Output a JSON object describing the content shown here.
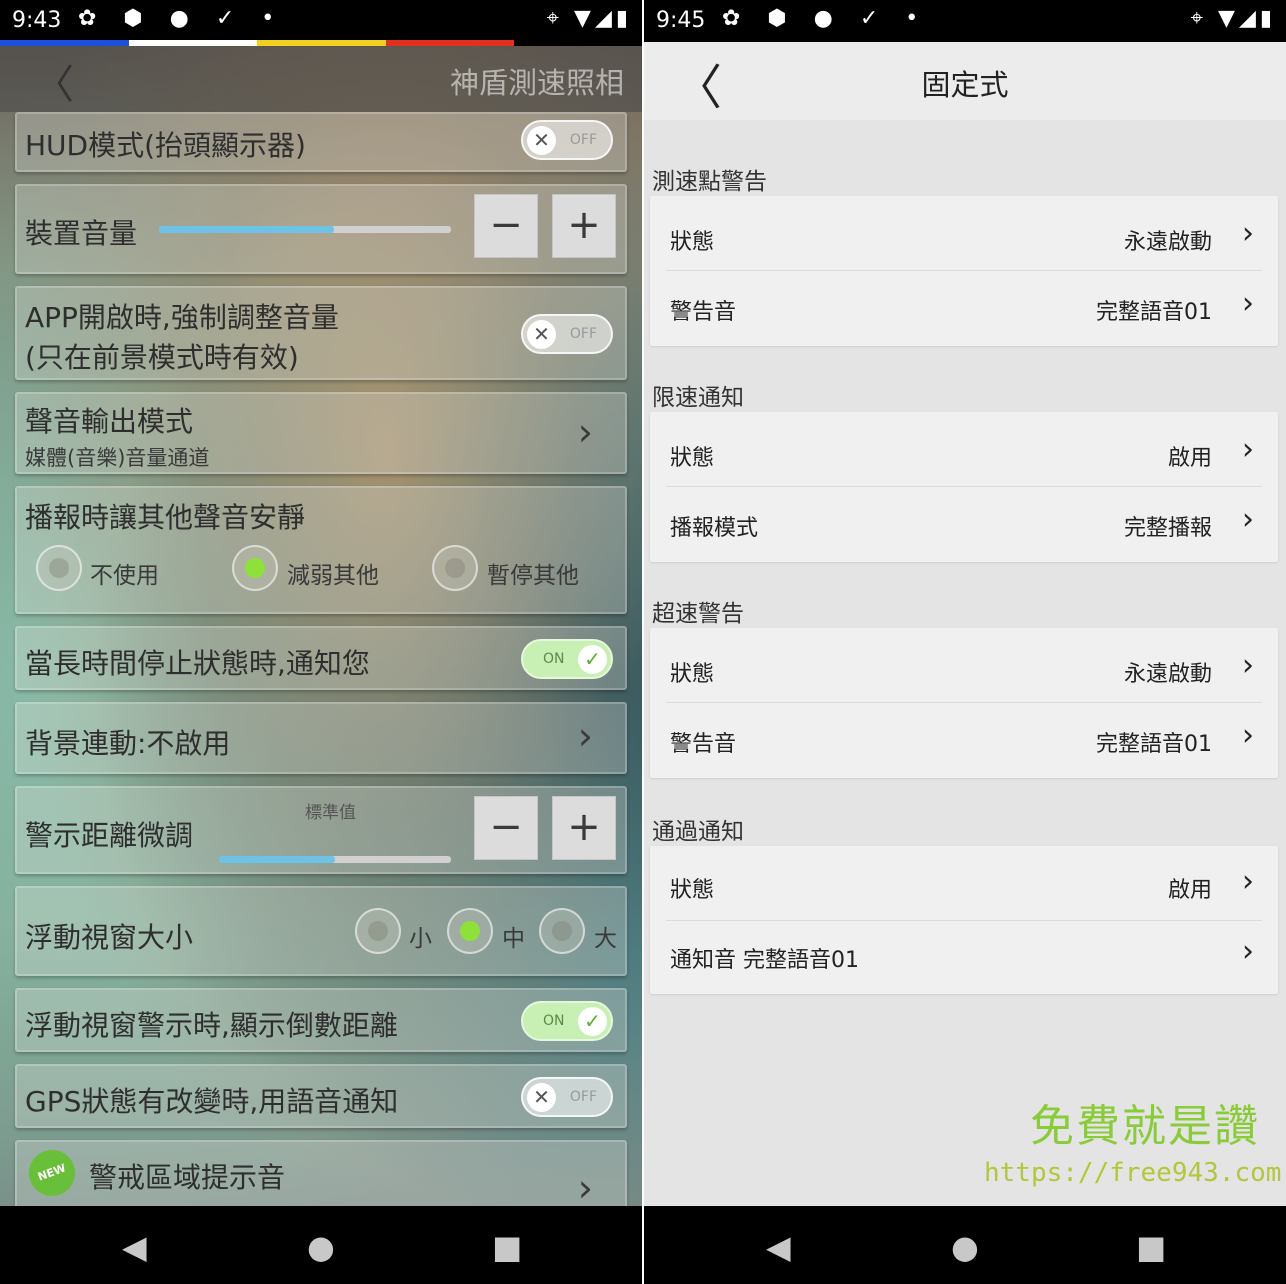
{
  "left": {
    "status": {
      "time": "9:43",
      "left_icons": "✿ ⬢ ● ✓ •",
      "right_icons": "⌖ ▼◢▮"
    },
    "strip_colors": [
      "#1e4fd8",
      "#ffffff",
      "#f0d21e",
      "#e03020"
    ],
    "header": {
      "back": "〈",
      "title": "神盾測速照相"
    },
    "hud": {
      "label": "HUD模式(抬頭顯示器)",
      "toggle": "OFF"
    },
    "volume": {
      "label": "裝置音量",
      "minus": "−",
      "plus": "+",
      "level": 0.6
    },
    "force_volume": {
      "line1": "APP開啟時,強制調整音量",
      "line2": "(只在前景模式時有效)",
      "toggle": "OFF"
    },
    "output": {
      "label": "聲音輸出模式",
      "sub": "媒體(音樂)音量通道",
      "chevron": "›"
    },
    "quiet": {
      "label": "播報時讓其他聲音安靜",
      "options": [
        "不使用",
        "減弱其他",
        "暫停其他"
      ],
      "selected": 1
    },
    "long_stop": {
      "label": "當長時間停止狀態時,通知您",
      "toggle": "ON"
    },
    "background": {
      "label": "背景連動:不啟用",
      "chevron": "›"
    },
    "distance": {
      "label": "警示距離微調",
      "value_label": "標準值",
      "minus": "−",
      "plus": "+",
      "level": 0.5
    },
    "float_size": {
      "label": "浮動視窗大小",
      "options": [
        "小",
        "中",
        "大"
      ],
      "selected": 1
    },
    "float_countdown": {
      "label": "浮動視窗警示時,顯示倒數距離",
      "toggle": "ON"
    },
    "gps": {
      "label": "GPS狀態有改變時,用語音通知",
      "toggle": "OFF"
    },
    "zone": {
      "badge": "NEW",
      "label": "警戒區域提示音",
      "chevron": "›"
    },
    "nav": {
      "back": "◀",
      "home": "●",
      "recent": "■"
    }
  },
  "right": {
    "status": {
      "time": "9:45",
      "left_icons": "✿ ⬢ ● ✓ •",
      "right_icons": "⌖ ▼◢▮"
    },
    "header": {
      "back": "〈",
      "title": "固定式"
    },
    "sections": [
      {
        "title": "測速點警告",
        "rows": [
          {
            "key": "狀態",
            "value": "永遠啟動"
          },
          {
            "key": "警告音",
            "value": "完整語音01"
          }
        ]
      },
      {
        "title": "限速通知",
        "rows": [
          {
            "key": "狀態",
            "value": "啟用"
          },
          {
            "key": "播報模式",
            "value": "完整播報"
          }
        ]
      },
      {
        "title": "超速警告",
        "rows": [
          {
            "key": "狀態",
            "value": "永遠啟動"
          },
          {
            "key": "警告音",
            "value": "完整語音01"
          }
        ]
      },
      {
        "title": "通過通知",
        "rows": [
          {
            "key": "狀態",
            "value": "啟用"
          },
          {
            "key": "通知音 完整語音01",
            "value": ""
          }
        ]
      }
    ],
    "chevron": "›",
    "watermark": {
      "title": "免費就是讚",
      "url": "https://free943.com"
    },
    "nav": {
      "back": "◀",
      "home": "●",
      "recent": "■"
    }
  }
}
